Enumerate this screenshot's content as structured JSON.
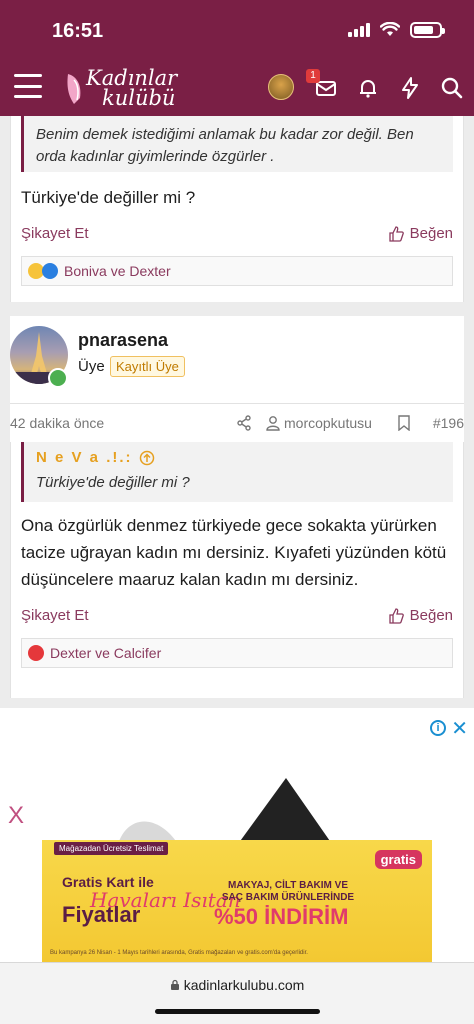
{
  "status": {
    "time": "16:51"
  },
  "header": {
    "logo_line1": "Kadınlar",
    "logo_line2": "kulübü",
    "notif_badge": "1"
  },
  "post1": {
    "quote": "Benim demek istediğimi anlamak bu kadar zor değil. Ben orda kadınlar giyimlerinde özgürler .",
    "text": "Türkiye'de değiller mi ?",
    "report": "Şikayet Et",
    "like": "Beğen",
    "reactions": "Boniva ve Dexter"
  },
  "post2": {
    "username": "pnarasena",
    "role": "Üye",
    "role_badge": "Kayıtlı Üye",
    "time": "42 dakika önce",
    "quoted_user": "morcopkutusu",
    "post_number": "#196",
    "quote_author": "N e V a .!.:",
    "quote_text": "Türkiye'de değiller mi ?",
    "text": "Ona özgürlük denmez türkiyede gece sokakta yürürken tacize uğrayan kadın mı dersiniz. Kıyafeti yüzünden kötü düşüncelere maaruz kalan kadın mı dersiniz.",
    "report": "Şikayet Et",
    "like": "Beğen",
    "reactions": "Dexter ve Calcifer"
  },
  "ad": {
    "tag": "Mağazadan Ücretsiz Teslimat",
    "line1": "Gratis Kart ile",
    "line2": "Havaları Isıtan",
    "line3": "Fiyatlar",
    "mid": "MAKYAJ, CİLT BAKIM VE SAÇ BAKIM ÜRÜNLERİNDE",
    "pct": "%50 İNDİRİM",
    "brand": "gratis",
    "note": "Bu kampanya 26 Nisan - 1 Mayıs tarihleri arasında, Gratis mağazaları ve gratis.com'da geçerlidir."
  },
  "browser": {
    "url": "kadinlarkulubu.com"
  },
  "colors": {
    "brand": "#7a1f45",
    "link": "#8a3a5e"
  }
}
